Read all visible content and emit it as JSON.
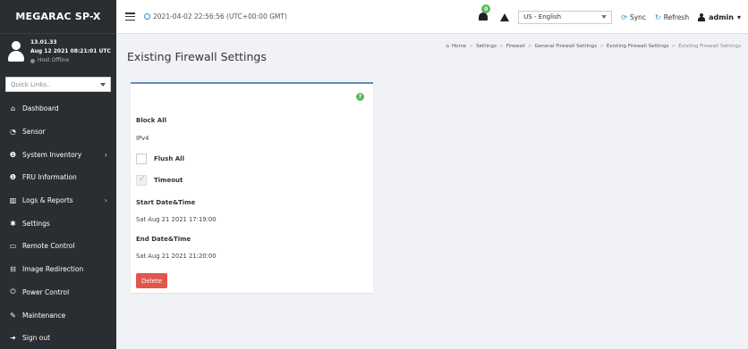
{
  "app": {
    "brand": "MEGARAC SP-X"
  },
  "user_panel": {
    "version": "13.01.33",
    "datetime": "Aug 12 2021 08:21:01 UTC",
    "host_status": "Host Offline"
  },
  "quick_links": {
    "placeholder": "Quick Links.."
  },
  "sidebar": {
    "items": [
      {
        "label": "Dashboard",
        "icon": "home-icon"
      },
      {
        "label": "Sensor",
        "icon": "gauge-icon"
      },
      {
        "label": "System Inventory",
        "icon": "info-icon",
        "has_children": true
      },
      {
        "label": "FRU Information",
        "icon": "info-icon"
      },
      {
        "label": "Logs & Reports",
        "icon": "chart-icon",
        "has_children": true
      },
      {
        "label": "Settings",
        "icon": "gear-icon"
      },
      {
        "label": "Remote Control",
        "icon": "monitor-icon"
      },
      {
        "label": "Image Redirection",
        "icon": "disk-icon"
      },
      {
        "label": "Power Control",
        "icon": "power-icon"
      },
      {
        "label": "Maintenance",
        "icon": "wrench-icon"
      },
      {
        "label": "Sign out",
        "icon": "signout-icon"
      }
    ]
  },
  "topbar": {
    "datetime": "2021-04-02 22:56:56 (UTC+00:00 GMT)",
    "notification_count": "0",
    "language": "US - English",
    "sync": "Sync",
    "refresh": "Refresh",
    "user": "admin"
  },
  "page": {
    "title": "Existing Firewall Settings",
    "breadcrumb": [
      "Home",
      "Settings",
      "Firewall",
      "General Firewall Settings",
      "Existing Firewall Settings",
      "Existing Firewall Settings"
    ]
  },
  "card": {
    "rule_title": "Block All",
    "protocol": "IPv4",
    "flush_all": {
      "label": "Flush All",
      "checked": false
    },
    "timeout": {
      "label": "Timeout",
      "checked": true
    },
    "start_label": "Start Date&Time",
    "start_value": "Sat Aug 21 2021 17:19:00",
    "end_label": "End Date&Time",
    "end_value": "Sat Aug 21 2021 21:20:00",
    "delete_label": "Delete"
  },
  "colors": {
    "sidebar_bg": "#2a2d32",
    "accent": "#2a8fd0",
    "danger": "#e2574c",
    "success": "#5cb85c"
  }
}
